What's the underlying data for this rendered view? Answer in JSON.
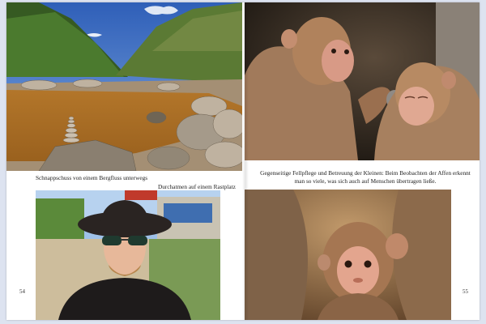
{
  "captions": {
    "river": "Schnappschuss von einem Bergfluss unterwegs",
    "rest": "Durchatmen auf einem Rastplatz",
    "monkeys": "Gegenseitige Fellpflege und Betreuung der Kleinen: Beim Beobachten der Affen erkennt man so viele, was sich auch auf Menschen übertragen ließe."
  },
  "page_numbers": {
    "left": "54",
    "right": "55"
  },
  "colors": {
    "background": "#dde3f0",
    "paper": "#ffffff",
    "text": "#222222"
  }
}
